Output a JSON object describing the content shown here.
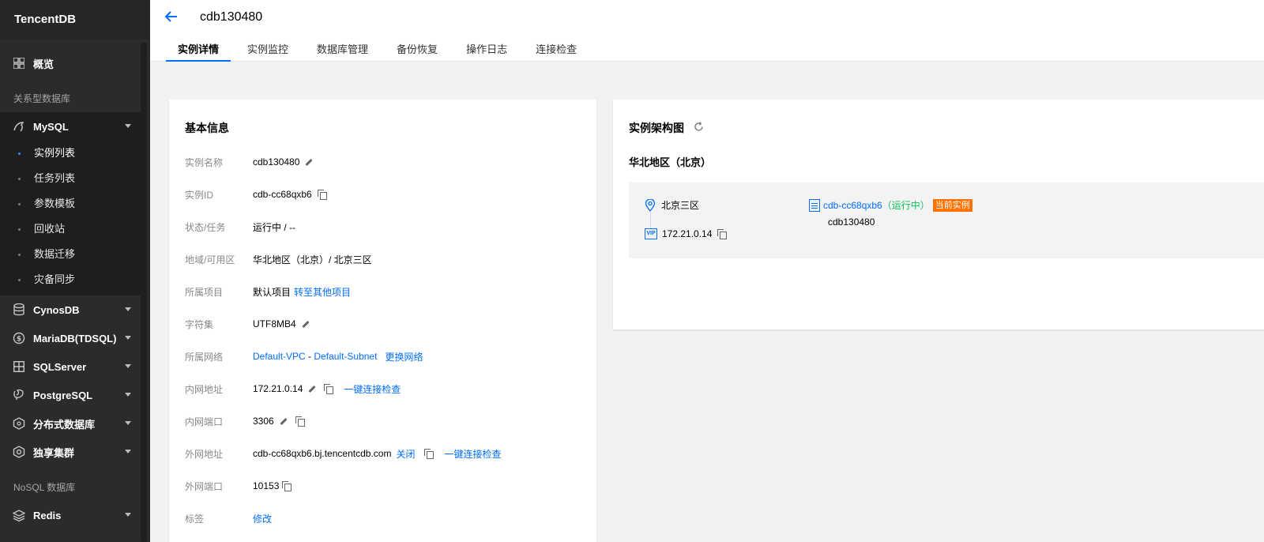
{
  "sidebar": {
    "logo": "TencentDB",
    "overview": "概览",
    "section_relational": "关系型数据库",
    "mysql": "MySQL",
    "mysql_sub": [
      "实例列表",
      "任务列表",
      "参数模板",
      "回收站",
      "数据迁移",
      "灾备同步"
    ],
    "items": [
      "CynosDB",
      "MariaDB(TDSQL)",
      "SQLServer",
      "PostgreSQL",
      "分布式数据库",
      "独享集群"
    ],
    "section_nosql": "NoSQL 数据库",
    "redis": "Redis"
  },
  "header": {
    "title": "cdb130480",
    "tabs": [
      "实例详情",
      "实例监控",
      "数据库管理",
      "备份恢复",
      "操作日志",
      "连接检查"
    ]
  },
  "basic": {
    "title": "基本信息",
    "rows": {
      "name_label": "实例名称",
      "name_value": "cdb130480",
      "id_label": "实例ID",
      "id_value": "cdb-cc68qxb6",
      "status_label": "状态/任务",
      "status_value": "运行中 / --",
      "region_label": "地域/可用区",
      "region_value": "华北地区（北京）/ 北京三区",
      "project_label": "所属项目",
      "project_value": "默认项目",
      "project_link": "转至其他项目",
      "charset_label": "字符集",
      "charset_value": "UTF8MB4",
      "network_label": "所属网络",
      "network_vpc": "Default-VPC",
      "network_sep": " - ",
      "network_subnet": "Default-Subnet",
      "network_change": "更换网络",
      "intranet_label": "内网地址",
      "intranet_value": "172.21.0.14",
      "intranet_check": "一键连接检查",
      "port_label": "内网端口",
      "port_value": "3306",
      "extranet_label": "外网地址",
      "extranet_value": "cdb-cc68qxb6.bj.tencentcdb.com",
      "extranet_close": "关闭",
      "extranet_check": "一键连接检查",
      "extport_label": "外网端口",
      "extport_value": "10153",
      "tag_label": "标签",
      "tag_link": "修改"
    }
  },
  "arch": {
    "title": "实例架构图",
    "region": "华北地区（北京）",
    "zone": "北京三区",
    "vip_label": "VIP",
    "vip": "172.21.0.14",
    "instance_id": "cdb-cc68qxb6",
    "instance_status_open": "（",
    "instance_status": "运行中",
    "instance_status_close": "）",
    "badge": "当前实例",
    "instance_name": "cdb130480"
  },
  "colors": {
    "brand": "#006eff",
    "running": "#0abf5b",
    "badge": "#ff7200",
    "sidebar": "#2b2b2b"
  }
}
